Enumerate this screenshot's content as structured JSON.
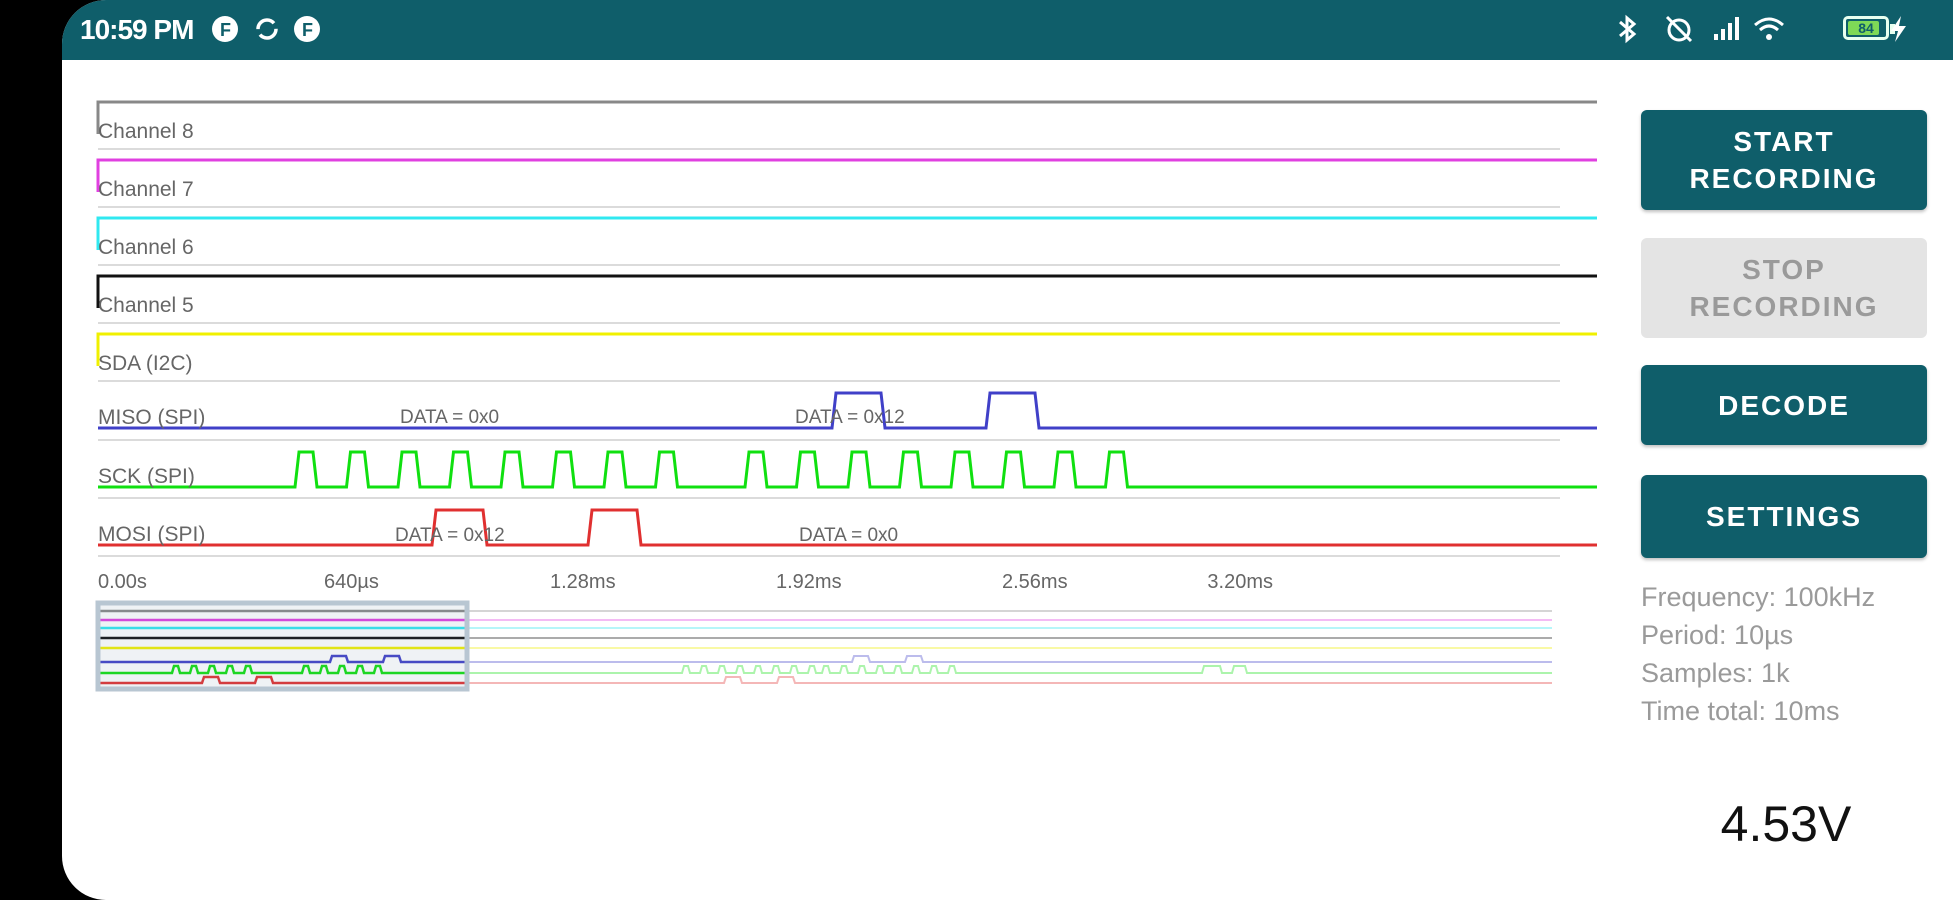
{
  "status_bar": {
    "time": "10:59 PM",
    "left_icons": [
      "notification-f-icon",
      "sync-icon",
      "notification-f-icon"
    ],
    "right_icons": [
      "bluetooth-icon",
      "alarm-off-icon",
      "signal-icon",
      "wifi-icon",
      "battery-icon",
      "charging-icon"
    ],
    "battery_level": 0.78,
    "battery_label": "84"
  },
  "channels": [
    {
      "label": "Channel 8",
      "color": "#888888"
    },
    {
      "label": "Channel 7",
      "color": "#e040e0"
    },
    {
      "label": "Channel 6",
      "color": "#30e8f0"
    },
    {
      "label": "Channel 5",
      "color": "#111111"
    },
    {
      "label": "SDA (I2C)",
      "color": "#f0f000"
    },
    {
      "label": "MISO (SPI)",
      "color": "#4040c8"
    },
    {
      "label": "SCK (SPI)",
      "color": "#10e010"
    },
    {
      "label": "MOSI (SPI)",
      "color": "#e03030"
    }
  ],
  "annotations": {
    "miso": [
      "DATA = 0x0",
      "DATA = 0x12"
    ],
    "mosi": [
      "DATA = 0x12",
      "DATA = 0x0"
    ]
  },
  "time_axis": {
    "ticks": [
      "0.00s",
      "640µs",
      "1.28ms",
      "1.92ms",
      "2.56ms",
      "3.20ms"
    ]
  },
  "buttons": {
    "start": "START\nRECORDING",
    "stop": "STOP\nRECORDING",
    "decode": "DECODE",
    "settings": "SETTINGS"
  },
  "info": {
    "frequency": "Frequency: 100kHz",
    "period": "Period: 10µs",
    "samples": "Samples: 1k",
    "time_total": "Time total: 10ms"
  },
  "voltage": "4.53V"
}
